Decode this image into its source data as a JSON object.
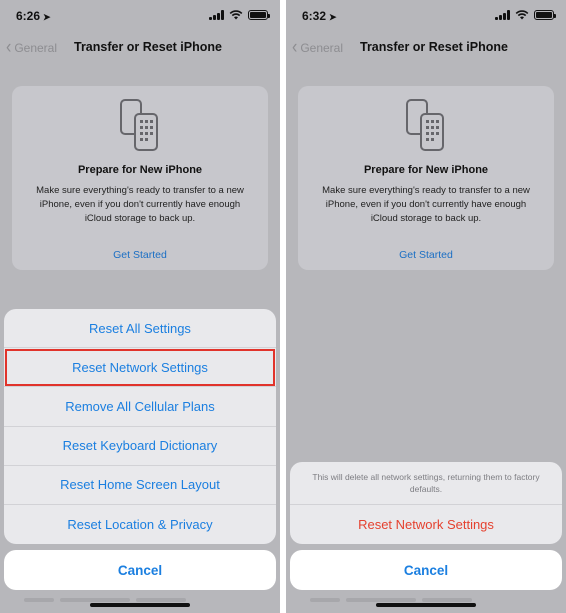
{
  "left": {
    "time": "6:26",
    "nav": {
      "back_label": "General",
      "title": "Transfer or Reset iPhone"
    },
    "card": {
      "title": "Prepare for New iPhone",
      "description": "Make sure everything's ready to transfer to a new iPhone, even if you don't currently have enough iCloud storage to back up.",
      "link": "Get Started"
    },
    "sheet_items": [
      "Reset All Settings",
      "Reset Network Settings",
      "Remove All Cellular Plans",
      "Reset Keyboard Dictionary",
      "Reset Home Screen Layout",
      "Reset Location & Privacy"
    ],
    "highlighted_item": "Reset Network Settings",
    "cancel": "Cancel"
  },
  "right": {
    "time": "6:32",
    "nav": {
      "back_label": "General",
      "title": "Transfer or Reset iPhone"
    },
    "card": {
      "title": "Prepare for New iPhone",
      "description": "Make sure everything's ready to transfer to a new iPhone, even if you don't currently have enough iCloud storage to back up.",
      "link": "Get Started"
    },
    "confirm_message": "This will delete all network settings, returning them to factory defaults.",
    "confirm_action": "Reset Network Settings",
    "cancel": "Cancel"
  },
  "icons": {
    "location": "location-arrow-icon",
    "signal": "cellular-signal-icon",
    "wifi": "wifi-icon",
    "battery": "battery-icon",
    "back": "chevron-left-icon",
    "card": "two-phones-transfer-icon"
  },
  "colors": {
    "accent": "#1b7fe0",
    "destructive": "#e5412f",
    "highlight_border": "#e1332b",
    "dim_background": "#b7b7bb"
  }
}
